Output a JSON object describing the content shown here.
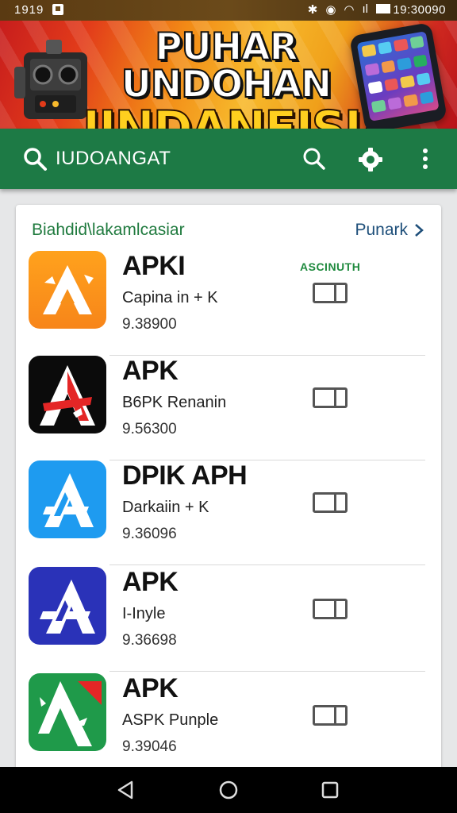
{
  "status_bar": {
    "time_left": "1919",
    "time_right": "19:30090",
    "icons": [
      "notification-icon",
      "bluetooth-icon",
      "location-icon",
      "wifi-icon",
      "signal-icon",
      "battery-icon"
    ]
  },
  "banner": {
    "line1": "PUHAR UNDOHAN",
    "line2": "IINDANEISIA"
  },
  "toolbar": {
    "title": "IUDOANGAT",
    "color": "#1d7a45"
  },
  "section": {
    "title": "Biahdid\\lakamlcasiar",
    "more_label": "Punark"
  },
  "apps": [
    {
      "name": "APKI",
      "subtitle": "Capina in + K",
      "version": "9.38900",
      "badge": "ASCINUTH",
      "icon": "orange-a-icon"
    },
    {
      "name": "APK",
      "subtitle": "B6PK Renanin",
      "version": "9.56300",
      "badge": "",
      "icon": "black-red-a-icon"
    },
    {
      "name": "DPIK APH",
      "subtitle": "Darkaiin + K",
      "version": "9.36096",
      "badge": "",
      "icon": "blue-a-icon"
    },
    {
      "name": "APK",
      "subtitle": "I-Inyle",
      "version": "9.36698",
      "badge": "",
      "icon": "navy-a-icon"
    },
    {
      "name": "APK",
      "subtitle": "ASPK Punple",
      "version": "9.39046",
      "badge": "",
      "icon": "green-a-icon"
    }
  ],
  "colors": {
    "accent_green": "#1d7a45",
    "section_title": "#1f7a3e",
    "link_blue": "#1e4f7a"
  }
}
